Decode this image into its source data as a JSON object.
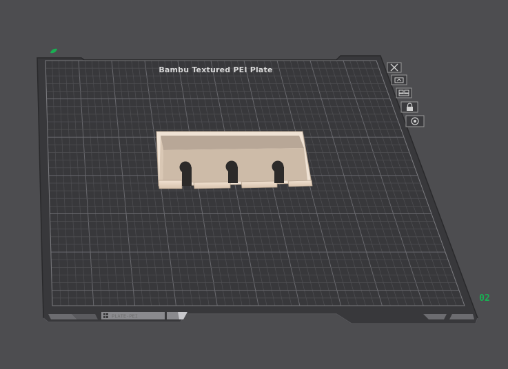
{
  "plate": {
    "title": "Bambu Textured PEI Plate",
    "number": "02",
    "label": "PLATE-PEI",
    "colors": {
      "background": "#4d4d50",
      "plate": "#38383b",
      "grid_minor": "#4f4f53",
      "grid_major": "#6a6a6f",
      "accent": "#18b052",
      "model": "#e3d0bd"
    }
  },
  "toolbar": {
    "buttons": [
      {
        "name": "delete-plate-button",
        "icon": "close-icon"
      },
      {
        "name": "orient-plate-button",
        "icon": "orient-icon"
      },
      {
        "name": "arrange-plate-button",
        "icon": "arrange-icon"
      },
      {
        "name": "lock-plate-button",
        "icon": "lock-icon"
      },
      {
        "name": "plate-settings-button",
        "icon": "gear-icon"
      }
    ]
  },
  "model": {
    "name": "tray-model",
    "holes": 3
  }
}
